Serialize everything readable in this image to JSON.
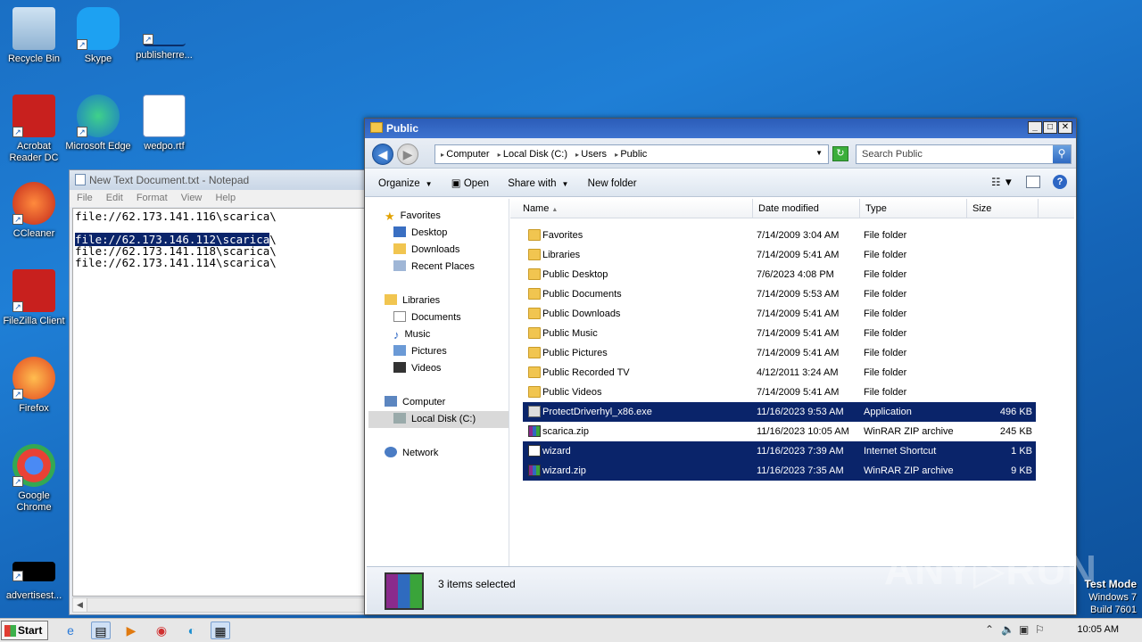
{
  "desktop": {
    "icons": [
      {
        "label": "Recycle Bin",
        "icon": "recycle-bin-icon"
      },
      {
        "label": "Skype",
        "icon": "skype-icon"
      },
      {
        "label": "publisherre...",
        "icon": "file-icon"
      },
      {
        "label": "Acrobat Reader DC",
        "icon": "acrobat-icon"
      },
      {
        "label": "Microsoft Edge",
        "icon": "edge-icon"
      },
      {
        "label": "wedpo.rtf",
        "icon": "word-doc-icon"
      },
      {
        "label": "CCleaner",
        "icon": "ccleaner-icon"
      },
      {
        "label": "FileZilla Client",
        "icon": "filezilla-icon"
      },
      {
        "label": "Firefox",
        "icon": "firefox-icon"
      },
      {
        "label": "Google Chrome",
        "icon": "chrome-icon"
      },
      {
        "label": "advertisest...",
        "icon": "file-icon"
      }
    ]
  },
  "notepad": {
    "title": "New Text Document.txt - Notepad",
    "menu": [
      "File",
      "Edit",
      "Format",
      "View",
      "Help"
    ],
    "lines": [
      "file://62.173.141.116\\scarica\\",
      "",
      "file://62.173.146.112\\scarica\\",
      "file://62.173.141.118\\scarica\\",
      "file://62.173.141.114\\scarica\\"
    ],
    "selected_text": "file://62.173.146.112\\scarica",
    "selected_rest": "\\"
  },
  "explorer": {
    "title": "Public",
    "window_buttons": {
      "minimize": "_",
      "maximize": "□",
      "close": "✕"
    },
    "breadcrumbs": [
      "Computer",
      "Local Disk (C:)",
      "Users",
      "Public"
    ],
    "search_placeholder": "Search Public",
    "toolbar": {
      "organize": "Organize",
      "open": "Open",
      "share_with": "Share with",
      "new_folder": "New folder"
    },
    "nav": {
      "favorites": "Favorites",
      "favorites_items": [
        "Desktop",
        "Downloads",
        "Recent Places"
      ],
      "libraries": "Libraries",
      "libraries_items": [
        "Documents",
        "Music",
        "Pictures",
        "Videos"
      ],
      "computer": "Computer",
      "computer_items": [
        "Local Disk (C:)"
      ],
      "network": "Network"
    },
    "columns": {
      "name": "Name",
      "date": "Date modified",
      "type": "Type",
      "size": "Size"
    },
    "files": [
      {
        "name": "Favorites",
        "date": "7/14/2009 3:04 AM",
        "type": "File folder",
        "size": "",
        "kind": "folder",
        "selected": false
      },
      {
        "name": "Libraries",
        "date": "7/14/2009 5:41 AM",
        "type": "File folder",
        "size": "",
        "kind": "folder",
        "selected": false
      },
      {
        "name": "Public Desktop",
        "date": "7/6/2023 4:08 PM",
        "type": "File folder",
        "size": "",
        "kind": "folder",
        "selected": false
      },
      {
        "name": "Public Documents",
        "date": "7/14/2009 5:53 AM",
        "type": "File folder",
        "size": "",
        "kind": "folder",
        "selected": false
      },
      {
        "name": "Public Downloads",
        "date": "7/14/2009 5:41 AM",
        "type": "File folder",
        "size": "",
        "kind": "folder",
        "selected": false
      },
      {
        "name": "Public Music",
        "date": "7/14/2009 5:41 AM",
        "type": "File folder",
        "size": "",
        "kind": "folder",
        "selected": false
      },
      {
        "name": "Public Pictures",
        "date": "7/14/2009 5:41 AM",
        "type": "File folder",
        "size": "",
        "kind": "folder",
        "selected": false
      },
      {
        "name": "Public Recorded TV",
        "date": "4/12/2011 3:24 AM",
        "type": "File folder",
        "size": "",
        "kind": "folder",
        "selected": false
      },
      {
        "name": "Public Videos",
        "date": "7/14/2009 5:41 AM",
        "type": "File folder",
        "size": "",
        "kind": "folder",
        "selected": false
      },
      {
        "name": "ProtectDriverhyl_x86.exe",
        "date": "11/16/2023 9:53 AM",
        "type": "Application",
        "size": "496 KB",
        "kind": "exe",
        "selected": true
      },
      {
        "name": "scarica.zip",
        "date": "11/16/2023 10:05 AM",
        "type": "WinRAR ZIP archive",
        "size": "245 KB",
        "kind": "rar",
        "selected": false
      },
      {
        "name": "wizard",
        "date": "11/16/2023 7:39 AM",
        "type": "Internet Shortcut",
        "size": "1 KB",
        "kind": "url",
        "selected": true
      },
      {
        "name": "wizard.zip",
        "date": "11/16/2023 7:35 AM",
        "type": "WinRAR ZIP archive",
        "size": "9 KB",
        "kind": "rar",
        "selected": true
      }
    ],
    "status": "3 items selected"
  },
  "taskbar": {
    "start_label": "Start",
    "pinned": [
      "ie-icon",
      "explorer-icon",
      "media-player-icon",
      "chrome-icon",
      "edge-icon",
      "notepad-icon"
    ],
    "clock": "10:05 AM"
  },
  "overlay": {
    "watermark": "ANY▷RUN",
    "test_mode_line1": "Test Mode",
    "test_mode_line2": "Windows 7",
    "test_mode_line3": "Build 7601"
  }
}
